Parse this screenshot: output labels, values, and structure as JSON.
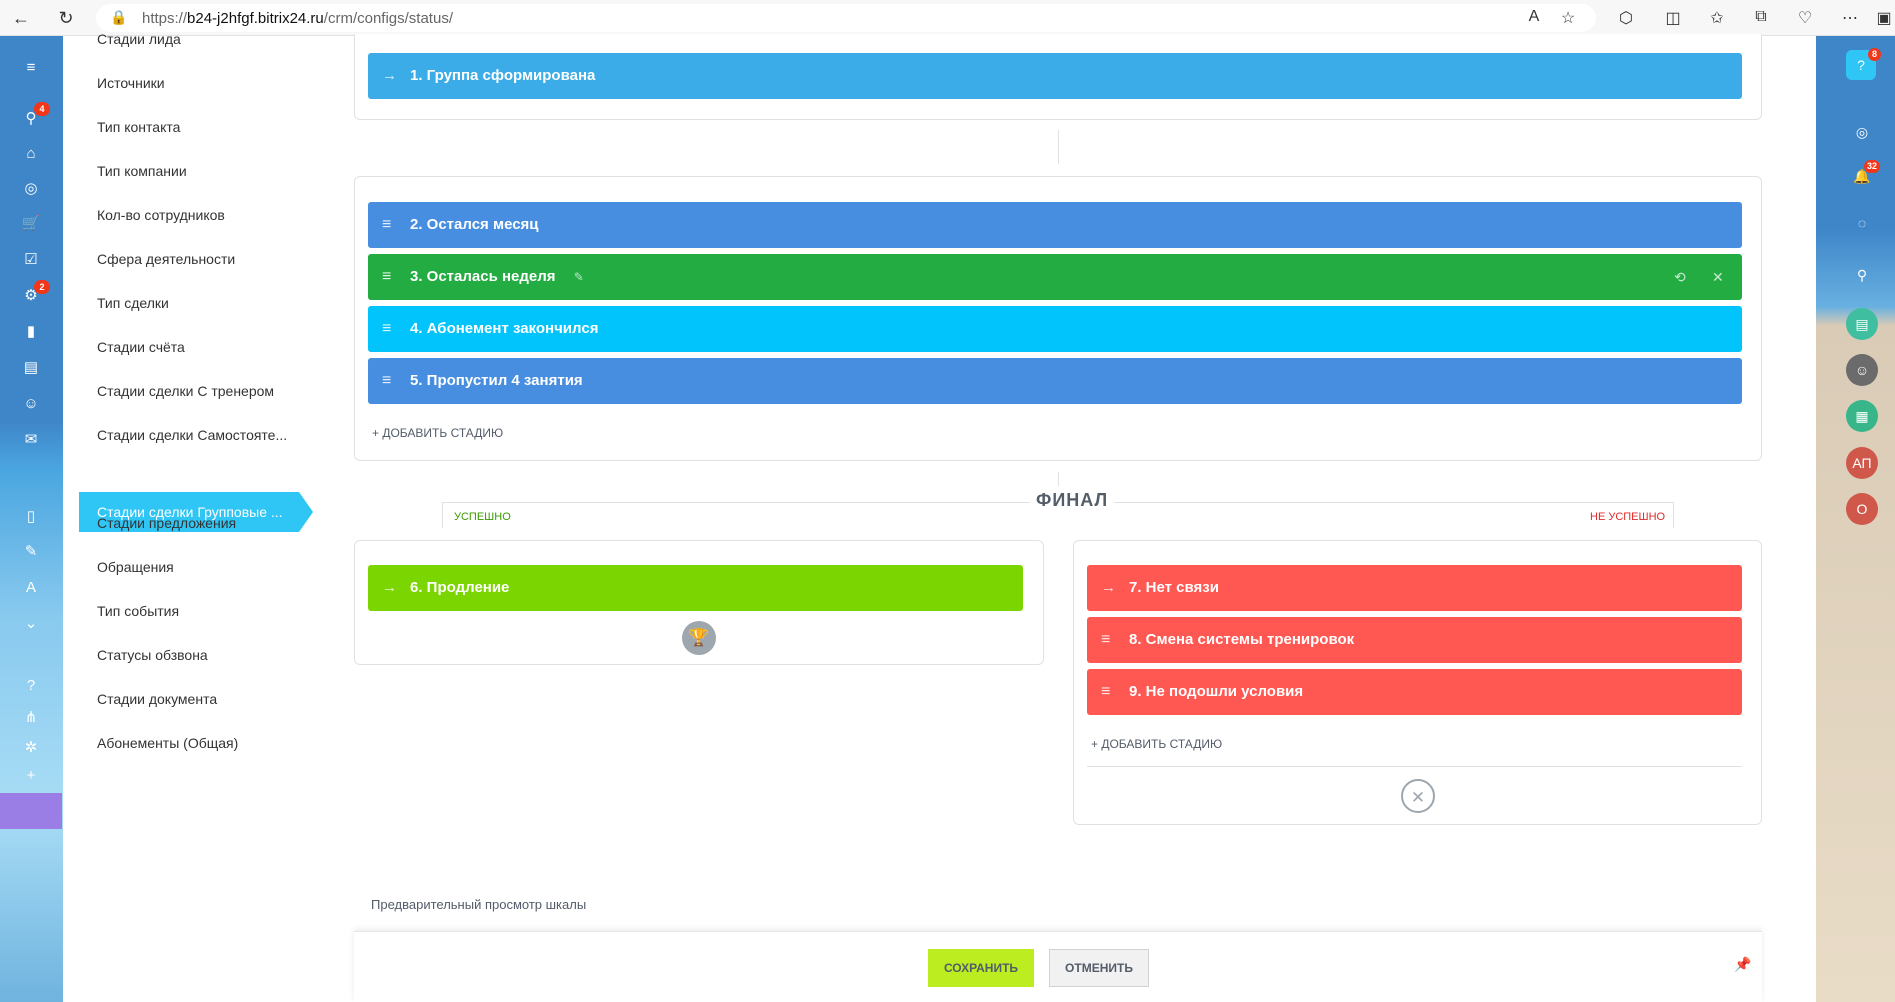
{
  "browser": {
    "url_prefix": "https://",
    "url_host": "b24-j2hfgf.bitrix24.ru",
    "url_path": "/crm/configs/status/"
  },
  "left_rail": {
    "badges": [
      "4",
      "2"
    ]
  },
  "right_rail": {
    "help_badge": "8",
    "notif_badge": "32",
    "avatar1": "АП",
    "avatar2": "О"
  },
  "menu": {
    "items": [
      "Стадии лида",
      "Источники",
      "Тип контакта",
      "Тип компании",
      "Кол-во сотрудников",
      "Сфера деятельности",
      "Тип сделки",
      "Стадии счёта",
      "Стадии сделки С тренером",
      "Стадии сделки Самостояте...",
      "Стадии сделки Групповые ...",
      "Стадии предложения",
      "Обращения",
      "Тип события",
      "Статусы обзвона",
      "Стадии документа",
      "Абонементы (Общая)"
    ]
  },
  "stages": {
    "initial": {
      "label": "1. Группа сформирована",
      "color": "#3bace8"
    },
    "process": [
      {
        "label": "2. Остался месяц",
        "color": "#478ee1"
      },
      {
        "label": "3. Осталась неделя",
        "color": "#22ac41"
      },
      {
        "label": "4. Абонемент закончился",
        "color": "#00c4fb"
      },
      {
        "label": "5. Пропустил 4 занятия",
        "color": "#478ee1"
      }
    ],
    "add_stage_label": "+ ДОБАВИТЬ СТАДИЮ",
    "final_title": "ФИНАЛ",
    "success_label": "УСПЕШНО",
    "fail_label": "НЕ УСПЕШНО",
    "success": {
      "label": "6. Продление",
      "color": "#7bd500"
    },
    "fail": [
      {
        "label": "7. Нет связи",
        "color": "#ff5752"
      },
      {
        "label": "8. Смена системы тренировок",
        "color": "#ff5752"
      },
      {
        "label": "9. Не подошли условия",
        "color": "#ff5752"
      }
    ]
  },
  "preview_label": "Предварительный просмотр шкалы",
  "footer": {
    "save": "СОХРАНИТЬ",
    "cancel": "ОТМЕНИТЬ"
  }
}
